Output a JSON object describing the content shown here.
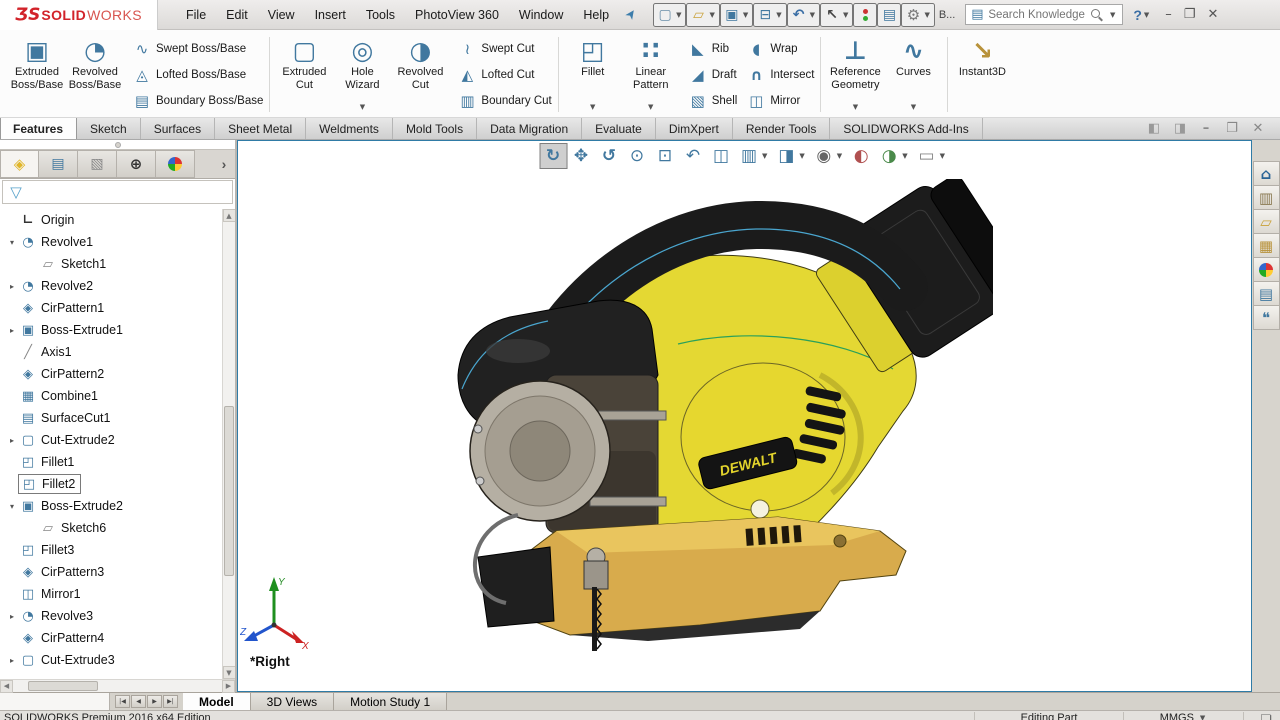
{
  "titlebar": {
    "logo": {
      "mark": "ƷS",
      "name_bold": "SOLID",
      "name_light": "WORKS"
    },
    "menus": [
      "File",
      "Edit",
      "View",
      "Insert",
      "Tools",
      "PhotoView 360",
      "Window",
      "Help"
    ],
    "quick_tools": [
      {
        "icon": "new-document-icon",
        "dropdown": true
      },
      {
        "icon": "open-icon",
        "dropdown": true
      },
      {
        "icon": "save-icon",
        "dropdown": true
      },
      {
        "icon": "print-icon",
        "dropdown": true
      },
      {
        "icon": "undo-icon",
        "dropdown": true
      },
      {
        "icon": "select-icon",
        "dropdown": true
      },
      {
        "icon": "rebuild-icon"
      },
      {
        "icon": "options-list-icon"
      },
      {
        "icon": "settings-gear-icon",
        "dropdown": true
      }
    ],
    "overflow_label": "B...",
    "search": {
      "placeholder": "Search Knowledge Base",
      "dropdown": true
    },
    "help_label": "?"
  },
  "ribbon": {
    "boss_large": [
      {
        "label": "Extruded Boss/Base",
        "icon": "extruded-boss-icon"
      },
      {
        "label": "Revolved Boss/Base",
        "icon": "revolved-boss-icon"
      }
    ],
    "boss_stack": [
      {
        "label": "Swept Boss/Base",
        "icon": "swept-boss-icon"
      },
      {
        "label": "Lofted Boss/Base",
        "icon": "lofted-boss-icon"
      },
      {
        "label": "Boundary Boss/Base",
        "icon": "boundary-boss-icon"
      }
    ],
    "cut_large": [
      {
        "label": "Extruded Cut",
        "icon": "extruded-cut-icon"
      },
      {
        "label": "Hole Wizard",
        "icon": "hole-wizard-icon",
        "dropdown": true
      },
      {
        "label": "Revolved Cut",
        "icon": "revolved-cut-icon"
      }
    ],
    "cut_stack": [
      {
        "label": "Swept Cut",
        "icon": "swept-cut-icon"
      },
      {
        "label": "Lofted Cut",
        "icon": "lofted-cut-icon"
      },
      {
        "label": "Boundary Cut",
        "icon": "boundary-cut-icon"
      }
    ],
    "feature_large": [
      {
        "label": "Fillet",
        "icon": "fillet-icon",
        "dropdown": true
      },
      {
        "label": "Linear Pattern",
        "icon": "linear-pattern-icon",
        "dropdown": true
      }
    ],
    "feature_stack1": [
      {
        "label": "Rib",
        "icon": "rib-icon"
      },
      {
        "label": "Draft",
        "icon": "draft-icon"
      },
      {
        "label": "Shell",
        "icon": "shell-icon"
      }
    ],
    "feature_stack2": [
      {
        "label": "Wrap",
        "icon": "wrap-icon"
      },
      {
        "label": "Intersect",
        "icon": "intersect-icon"
      },
      {
        "label": "Mirror",
        "icon": "mirror-icon"
      }
    ],
    "reference_large": [
      {
        "label": "Reference Geometry",
        "icon": "reference-geometry-icon",
        "dropdown": true
      },
      {
        "label": "Curves",
        "icon": "curves-icon",
        "dropdown": true
      }
    ],
    "instant_large": [
      {
        "label": "Instant3D",
        "icon": "instant3d-icon"
      }
    ]
  },
  "command_tabs": [
    {
      "label": "Features",
      "cls": "active"
    },
    {
      "label": "Sketch"
    },
    {
      "label": "Surfaces"
    },
    {
      "label": "Sheet Metal"
    },
    {
      "label": "Weldments"
    },
    {
      "label": "Mold Tools"
    },
    {
      "label": "Data Migration"
    },
    {
      "label": "Evaluate"
    },
    {
      "label": "DimXpert"
    },
    {
      "label": "Render Tools"
    },
    {
      "label": "SOLIDWORKS Add-Ins"
    }
  ],
  "doc_controls": [
    {
      "icon": "pane-left-icon"
    },
    {
      "icon": "pane-right-icon"
    },
    {
      "icon": "minimize-icon"
    },
    {
      "icon": "restore-icon"
    },
    {
      "icon": "close-icon"
    }
  ],
  "left_panel": {
    "tabs": [
      {
        "icon": "featuremanager-icon",
        "cls": "active"
      },
      {
        "icon": "propertymanager-icon"
      },
      {
        "icon": "configurationmanager-icon"
      },
      {
        "icon": "dimxpertmanager-icon"
      },
      {
        "icon": "displaymanager-icon"
      }
    ],
    "overflow_chevron": "›",
    "tree": [
      {
        "label": "Origin",
        "icon": "origin-icon",
        "indent": 1
      },
      {
        "label": "Revolve1",
        "icon": "revolve-icon",
        "indent": 1,
        "arrow": "expanded"
      },
      {
        "label": "Sketch1",
        "icon": "sketch-icon",
        "indent": 2
      },
      {
        "label": "Revolve2",
        "icon": "revolve-icon",
        "indent": 1,
        "arrow": "collapsed"
      },
      {
        "label": "CirPattern1",
        "icon": "cirpattern-icon",
        "indent": 1
      },
      {
        "label": "Boss-Extrude1",
        "icon": "boss-extrude-icon",
        "indent": 1,
        "arrow": "collapsed"
      },
      {
        "label": "Axis1",
        "icon": "axis-icon",
        "indent": 1
      },
      {
        "label": "CirPattern2",
        "icon": "cirpattern-icon",
        "indent": 1
      },
      {
        "label": "Combine1",
        "icon": "combine-icon",
        "indent": 1
      },
      {
        "label": "SurfaceCut1",
        "icon": "surfacecut-icon",
        "indent": 1
      },
      {
        "label": "Cut-Extrude2",
        "icon": "cut-extrude-icon",
        "indent": 1,
        "arrow": "collapsed"
      },
      {
        "label": "Fillet1",
        "icon": "fillet-icon",
        "indent": 1
      },
      {
        "label": "Fillet2",
        "icon": "fillet-icon",
        "indent": 1,
        "cls": "selected"
      },
      {
        "label": "Boss-Extrude2",
        "icon": "boss-extrude-icon",
        "indent": 1,
        "arrow": "expanded"
      },
      {
        "label": "Sketch6",
        "icon": "sketch-icon",
        "indent": 2
      },
      {
        "label": "Fillet3",
        "icon": "fillet-icon",
        "indent": 1
      },
      {
        "label": "CirPattern3",
        "icon": "cirpattern-icon",
        "indent": 1
      },
      {
        "label": "Mirror1",
        "icon": "mirror-icon",
        "indent": 1
      },
      {
        "label": "Revolve3",
        "icon": "revolve-icon",
        "indent": 1,
        "arrow": "collapsed"
      },
      {
        "label": "CirPattern4",
        "icon": "cirpattern-icon",
        "indent": 1
      },
      {
        "label": "Cut-Extrude3",
        "icon": "cut-extrude-icon",
        "indent": 1,
        "arrow": "collapsed"
      }
    ]
  },
  "viewport": {
    "heads_up": [
      {
        "icon": "rotate-scene-icon",
        "cls": "active"
      },
      {
        "icon": "pan-icon"
      },
      {
        "icon": "rotate-icon"
      },
      {
        "icon": "zoom-fit-icon"
      },
      {
        "icon": "zoom-area-icon"
      },
      {
        "icon": "prev-view-icon"
      },
      {
        "icon": "section-view-icon"
      },
      {
        "icon": "view-orientation-icon",
        "dropdown": true
      },
      {
        "icon": "display-style-icon",
        "dropdown": true
      },
      {
        "icon": "hide-show-icon",
        "dropdown": true
      },
      {
        "icon": "edit-appearance-icon"
      },
      {
        "icon": "apply-scene-icon",
        "dropdown": true
      },
      {
        "icon": "view-settings-icon",
        "dropdown": true
      }
    ],
    "orientation_label": "*Right",
    "model_brand": "DEWALT",
    "triad": {
      "x": "X",
      "y": "Y",
      "z": "Z"
    }
  },
  "task_pane": [
    {
      "icon": "home-icon"
    },
    {
      "icon": "design-library-icon"
    },
    {
      "icon": "file-explorer-icon"
    },
    {
      "icon": "view-palette-icon"
    },
    {
      "icon": "appearances-icon"
    },
    {
      "icon": "custom-properties-icon"
    },
    {
      "icon": "forum-icon"
    }
  ],
  "motion_bar": {
    "nav": [
      {
        "icon": "first-frame-icon"
      },
      {
        "icon": "prev-frame-icon"
      },
      {
        "icon": "next-frame-icon"
      },
      {
        "icon": "last-frame-icon"
      }
    ],
    "tabs": [
      {
        "label": "Model",
        "cls": "active"
      },
      {
        "label": "3D Views"
      },
      {
        "label": "Motion Study 1"
      }
    ]
  },
  "status_bar": {
    "product": "SOLIDWORKS Premium 2016 x64 Edition",
    "mode": "Editing Part",
    "units": "MMGS",
    "tag_icon": "tag-icon"
  }
}
